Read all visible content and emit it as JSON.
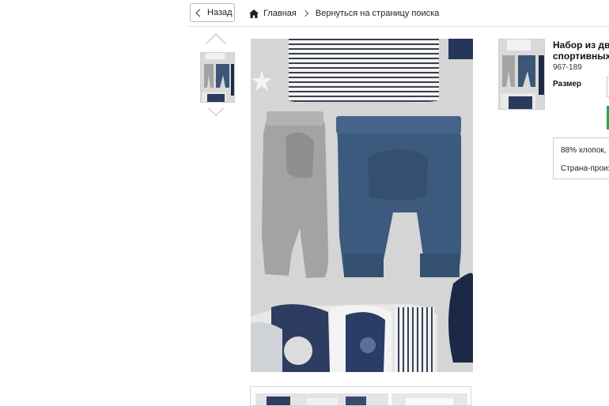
{
  "nav": {
    "back_label": "Назад",
    "home_label": "Главная",
    "search_label": "Вернуться на страницу поиска"
  },
  "product": {
    "title_line1": "Набор из дв",
    "title_line2": "спортивных",
    "code": "967-189",
    "size_label": "Размер"
  },
  "info": {
    "composition": "88% хлопок,",
    "country": "Страна-произ"
  },
  "colors": {
    "navy": "#2c3a5c",
    "denim": "#3d5a80",
    "grey": "#9a9a9a",
    "buy_green": "#28a745"
  }
}
